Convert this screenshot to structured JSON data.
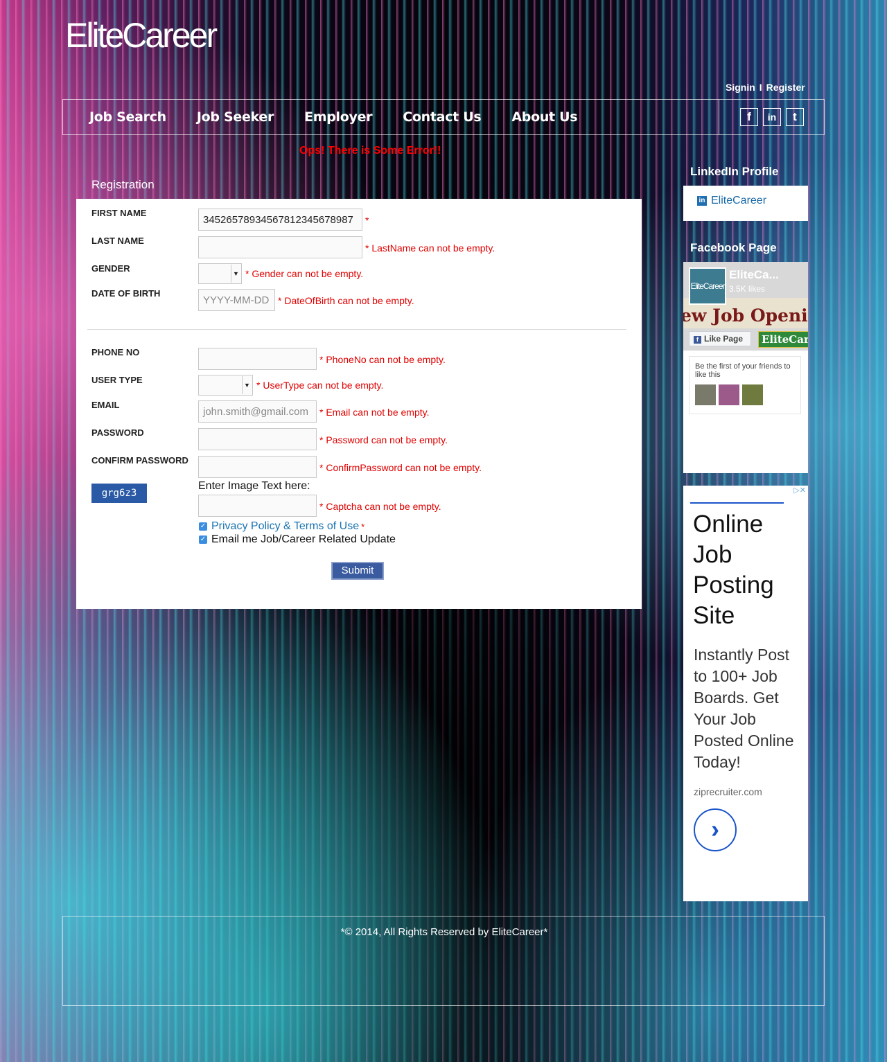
{
  "brand": {
    "logo_text": "EliteCareer"
  },
  "auth": {
    "signin": "Signin",
    "separator": "I",
    "register": "Register"
  },
  "nav": {
    "items": [
      {
        "label": "Job Search"
      },
      {
        "label": "Job Seeker"
      },
      {
        "label": "Employer"
      },
      {
        "label": "Contact Us"
      },
      {
        "label": "About Us"
      }
    ],
    "social": [
      {
        "icon": "facebook-icon",
        "glyph": "f"
      },
      {
        "icon": "linkedin-icon",
        "glyph": "in"
      },
      {
        "icon": "twitter-icon",
        "glyph": "t"
      }
    ]
  },
  "error_message": "Ops! There is Some Error!!",
  "form": {
    "title": "Registration",
    "first_name": {
      "label": "FIRST NAME",
      "value": "34526578934567812345678987",
      "required": "*"
    },
    "last_name": {
      "label": "LAST NAME",
      "value": "",
      "error": "* LastName can not be empty."
    },
    "gender": {
      "label": "GENDER",
      "value": "",
      "error": "* Gender can not be empty."
    },
    "dob": {
      "label": "DATE OF BIRTH",
      "placeholder": "YYYY-MM-DD",
      "error": "* DateOfBirth can not be empty."
    },
    "phone": {
      "label": "PHONE NO",
      "value": "",
      "error": "* PhoneNo can not be empty."
    },
    "user_type": {
      "label": "USER TYPE",
      "value": "",
      "error": "* UserType can not be empty."
    },
    "email": {
      "label": "EMAIL",
      "placeholder": "john.smith@gmail.com",
      "error": "* Email can not be empty."
    },
    "password": {
      "label": "PASSWORD",
      "value": "",
      "error": "* Password can not be empty."
    },
    "confirm_password": {
      "label": "CONFIRM PASSWORD",
      "value": "",
      "error": "* ConfirmPassword can not be empty."
    },
    "captcha": {
      "image_text": "grg6z3",
      "label": "Enter Image Text here:",
      "error": "* Captcha can not be empty."
    },
    "privacy": {
      "label": "Privacy Policy & Terms of Use",
      "checked": true,
      "required": "*"
    },
    "email_updates": {
      "label": "Email me Job/Career Related Update",
      "checked": true
    },
    "submit_label": "Submit"
  },
  "sidebar": {
    "linkedin": {
      "title": "LinkedIn Profile",
      "link": "EliteCareer"
    },
    "facebook": {
      "title": "Facebook Page",
      "page_name": "EliteCa...",
      "avatar_text": "EliteCareer",
      "likes": "3.5K likes",
      "cover_text": "ew Job Openi",
      "like_button": "Like Page",
      "tag_text": "EliteCar",
      "friends_text": "Be the first of your friends to like this"
    },
    "ad": {
      "headline": "Online Job Posting Site",
      "body": "Instantly Post to 100+ Job Boards. Get Your Job Posted Online Today!",
      "source": "ziprecruiter.com",
      "go_glyph": "›",
      "close_glyph": "▷✕"
    }
  },
  "footer": {
    "text": "*© 2014, All Rights Reserved by EliteCareer*"
  },
  "colors": {
    "error": "#e00000",
    "link": "#1a73b0",
    "submit": "#3a5ba0",
    "captcha_bg": "#2a5aa6"
  }
}
